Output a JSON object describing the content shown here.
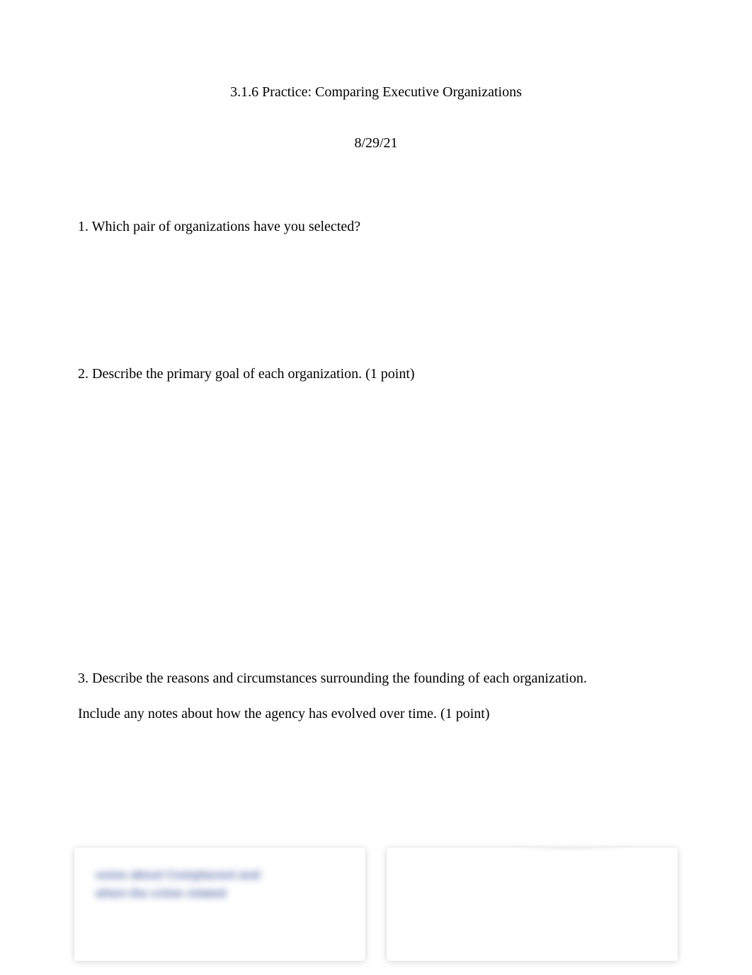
{
  "document": {
    "title": "3.1.6 Practice: Comparing Executive Organizations",
    "date": "8/29/21",
    "questions": {
      "q1": "1. Which pair of organizations have you selected?",
      "q2": "2. Describe the primary goal of each organization. (1 point)",
      "q3_line1": "3. Describe the reasons and circumstances surrounding the founding of each organization.",
      "q3_line2": "Include any notes about how the agency has evolved over time. (1 point)"
    }
  },
  "overlay": {
    "left_blurred_line1": "some about Complacent and",
    "left_blurred_line2": "when the crime related"
  }
}
